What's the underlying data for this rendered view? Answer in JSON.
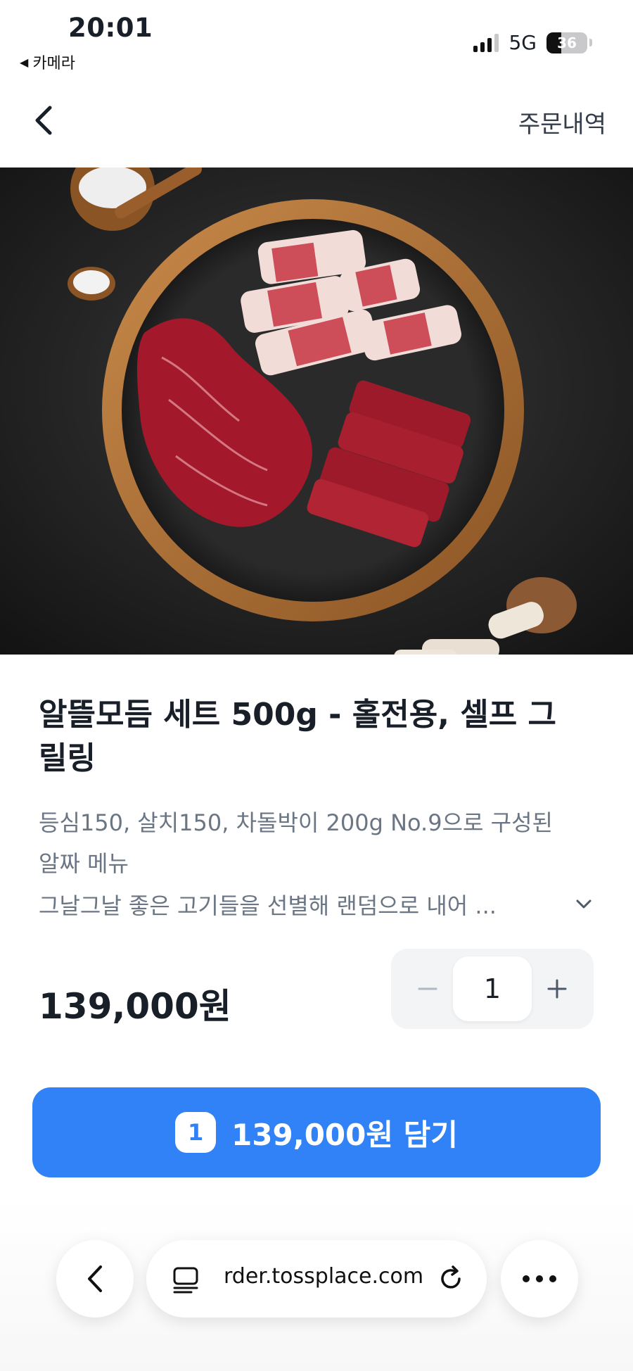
{
  "status_bar": {
    "time": "20:01",
    "back_app": "카메라",
    "network": "5G",
    "battery": "36",
    "battery_fraction": 0.36
  },
  "nav": {
    "back_icon": "chevron-left-icon",
    "order_history": "주문내역"
  },
  "product": {
    "image_alt": "product-photo",
    "title": "알뜰모듬 세트 500g - 홀전용, 셀프 그릴링",
    "description": "등심150, 살치150, 차돌박이 200g  No.9으로 구성된 알짜 메뉴",
    "description_more": "그날그날 좋은 고기들을 선별해 랜덤으로 내어 ...",
    "price": "139,000원"
  },
  "quantity": {
    "value": "1",
    "minus_icon": "minus-icon",
    "plus_icon": "plus-icon"
  },
  "cta": {
    "count": "1",
    "label": "139,000원 담기"
  },
  "browser": {
    "url": "rder.tossplace.com",
    "back_icon": "chevron-left-icon",
    "reader_icon": "reader-icon",
    "reload_icon": "reload-icon",
    "more_icon": "more-horizontal-icon"
  },
  "colors": {
    "accent": "#3182f6",
    "text_primary": "#191f28",
    "text_secondary": "#6b7684",
    "stepper_bg": "#f2f4f6"
  }
}
